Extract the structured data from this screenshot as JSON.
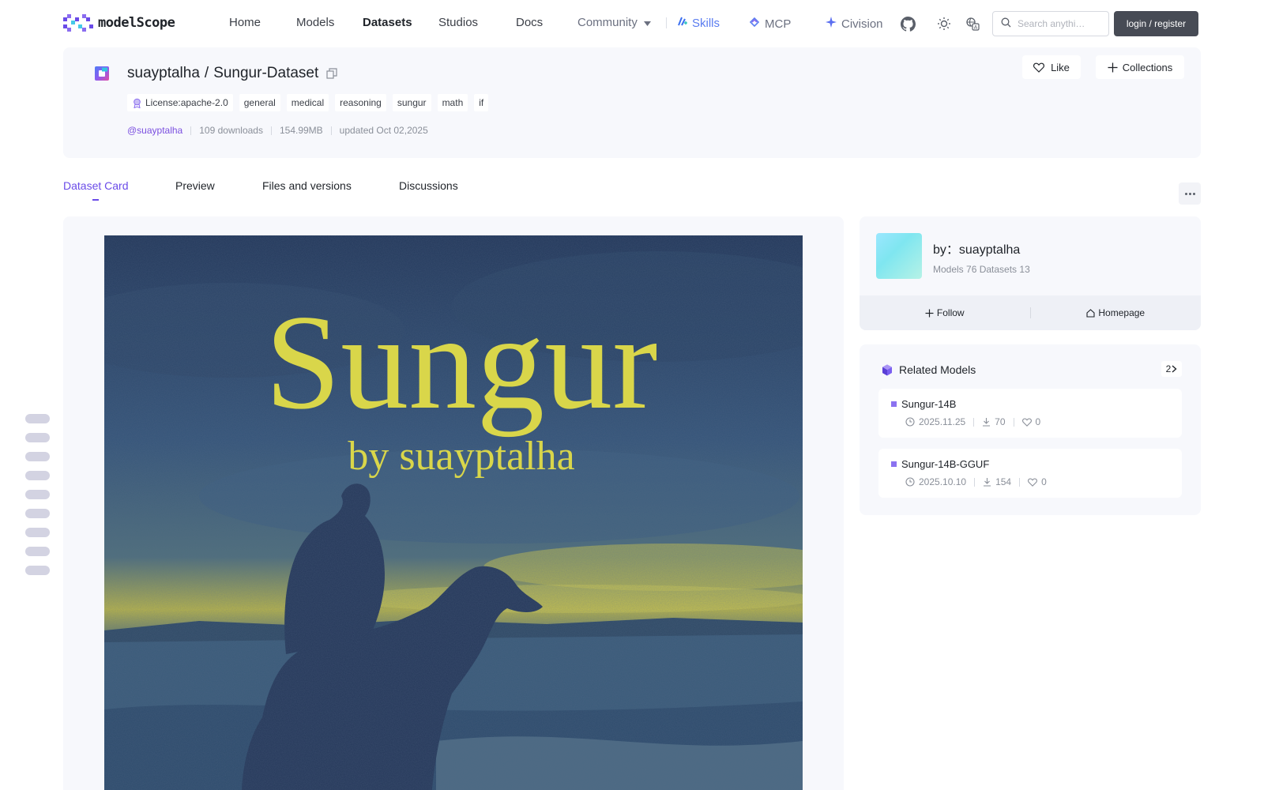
{
  "nav": {
    "logo_text": "modelScope",
    "links": [
      {
        "label": "Home"
      },
      {
        "label": "Models"
      },
      {
        "label": "Datasets"
      },
      {
        "label": "Studios"
      },
      {
        "label": "Docs"
      },
      {
        "label": "Community"
      }
    ],
    "ext_links": [
      {
        "label": "Skills",
        "icon": "skills-icon",
        "color": "#5a7cf0"
      },
      {
        "label": "MCP",
        "icon": "mcp-icon",
        "color": "#6b7080"
      },
      {
        "label": "Civision",
        "icon": "sparkle-icon",
        "color": "#6b7080"
      }
    ],
    "search_placeholder": "Search anythi…",
    "login_label": "login / register"
  },
  "dataset": {
    "owner": "suayptalha",
    "separator": "/",
    "name": "Sungur-Dataset",
    "tags": [
      {
        "label": "License:apache-2.0"
      },
      {
        "label": "general"
      },
      {
        "label": "medical"
      },
      {
        "label": "reasoning"
      },
      {
        "label": "sungur"
      },
      {
        "label": "math"
      },
      {
        "label": "if"
      }
    ],
    "author_handle": "@suayptalha",
    "downloads": "109 downloads",
    "size": "154.99MB",
    "updated": "updated Oct 02,2025",
    "like_label": "Like",
    "collections_label": "Collections"
  },
  "tabs": [
    {
      "label": "Dataset Card"
    },
    {
      "label": "Preview"
    },
    {
      "label": "Files and versions"
    },
    {
      "label": "Discussions"
    }
  ],
  "cover": {
    "title": "Sungur",
    "subtitle": "by suayptalha"
  },
  "author_card": {
    "by": "by：suayptalha",
    "counts": "Models 76  Datasets 13",
    "follow_label": "Follow",
    "homepage_label": "Homepage"
  },
  "related_models": {
    "title": "Related Models",
    "count": "2",
    "items": [
      {
        "name": "Sungur-14B",
        "date": "2025.11.25",
        "downloads": "70",
        "likes": "0"
      },
      {
        "name": "Sungur-14B-GGUF",
        "date": "2025.10.10",
        "downloads": "154",
        "likes": "0"
      }
    ]
  },
  "colors": {
    "accent": "#6a4be8",
    "login_bg": "#474b55",
    "card_bg": "#f7f8fc",
    "cover_title": "#d9d64a"
  }
}
